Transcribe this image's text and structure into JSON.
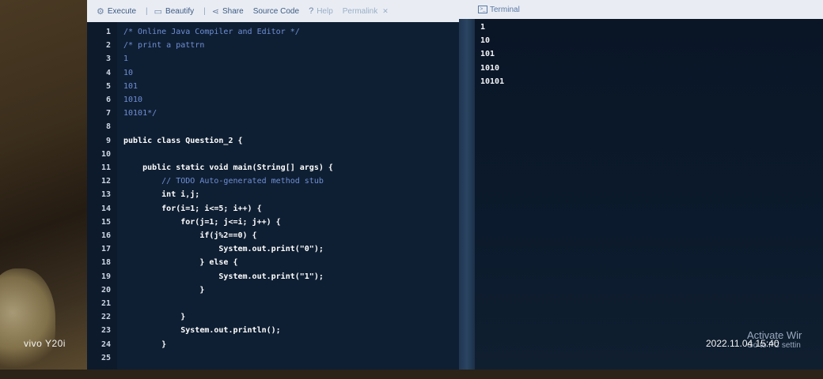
{
  "toolbar": {
    "execute_label": "Execute",
    "beautify_label": "Beautify",
    "share_label": "Share",
    "source_code_label": "Source Code",
    "help_label": "Help",
    "permalink_label": "Permalink",
    "separator": "|"
  },
  "terminal": {
    "title": "Terminal",
    "output": [
      "1",
      "10",
      "101",
      "1010",
      "10101"
    ]
  },
  "editor": {
    "lines": [
      {
        "n": "1",
        "text": "/* Online Java Compiler and Editor */"
      },
      {
        "n": "2",
        "text": "/* print a pattrn"
      },
      {
        "n": "3",
        "text": "1"
      },
      {
        "n": "4",
        "text": "10"
      },
      {
        "n": "5",
        "text": "101"
      },
      {
        "n": "6",
        "text": "1010"
      },
      {
        "n": "7",
        "text": "10101*/"
      },
      {
        "n": "8",
        "text": ""
      },
      {
        "n": "9",
        "text": "public class Question_2 {"
      },
      {
        "n": "10",
        "text": ""
      },
      {
        "n": "11",
        "text": "    public static void main(String[] args) {"
      },
      {
        "n": "12",
        "text": "        // TODO Auto-generated method stub"
      },
      {
        "n": "13",
        "text": "        int i,j;"
      },
      {
        "n": "14",
        "text": "        for(i=1; i<=5; i++) {"
      },
      {
        "n": "15",
        "text": "            for(j=1; j<=i; j++) {"
      },
      {
        "n": "16",
        "text": "                if(j%2==0) {"
      },
      {
        "n": "17",
        "text": "                    System.out.print(\"0\");"
      },
      {
        "n": "18",
        "text": "                } else {"
      },
      {
        "n": "19",
        "text": "                    System.out.print(\"1\");"
      },
      {
        "n": "20",
        "text": "                }"
      },
      {
        "n": "21",
        "text": ""
      },
      {
        "n": "22",
        "text": "            }"
      },
      {
        "n": "23",
        "text": "            System.out.println();"
      },
      {
        "n": "24",
        "text": "        }"
      },
      {
        "n": "25",
        "text": ""
      }
    ]
  },
  "overlay": {
    "activate_line1": "Activate Wir",
    "activate_line2": "Go to PC settin",
    "camera_brand": "vivo Y20i",
    "timestamp": "2022.11.04 15:40"
  }
}
